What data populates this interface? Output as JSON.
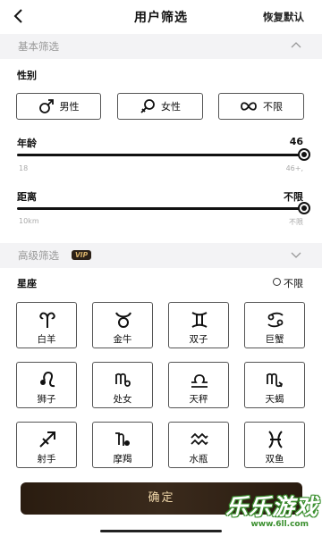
{
  "header": {
    "back_icon": "back-arrow-icon",
    "title": "用户筛选",
    "reset_label": "恢复默认"
  },
  "basic_section": {
    "title": "基本筛选",
    "gender": {
      "label": "性别",
      "options": [
        {
          "label": "男性",
          "icon": "male-icon"
        },
        {
          "label": "女性",
          "icon": "female-icon"
        },
        {
          "label": "不限",
          "icon": "infinity-icon"
        }
      ]
    },
    "age": {
      "label": "年龄",
      "value": "46",
      "min_label": "18",
      "max_label": "46+,",
      "slider_fraction": 1.0
    },
    "distance": {
      "label": "距离",
      "value": "不限",
      "min_label": "10km",
      "max_label": "不限",
      "slider_fraction": 1.0
    }
  },
  "advanced_section": {
    "title": "高级筛选",
    "vip_badge": "VIP",
    "zodiac": {
      "label": "星座",
      "unlimited_label": "不限",
      "signs": [
        {
          "label": "白羊",
          "icon": "aries-icon"
        },
        {
          "label": "金牛",
          "icon": "taurus-icon"
        },
        {
          "label": "双子",
          "icon": "gemini-icon"
        },
        {
          "label": "巨蟹",
          "icon": "cancer-icon"
        },
        {
          "label": "狮子",
          "icon": "leo-icon"
        },
        {
          "label": "处女",
          "icon": "virgo-icon"
        },
        {
          "label": "天秤",
          "icon": "libra-icon"
        },
        {
          "label": "天蝎",
          "icon": "scorpio-icon"
        },
        {
          "label": "射手",
          "icon": "sagittarius-icon"
        },
        {
          "label": "摩羯",
          "icon": "capricorn-icon"
        },
        {
          "label": "水瓶",
          "icon": "aquarius-icon"
        },
        {
          "label": "双鱼",
          "icon": "pisces-icon"
        }
      ]
    }
  },
  "confirm_label": "确定",
  "watermark": {
    "title": "乐乐游戏",
    "url": "www.6ll.com"
  },
  "colors": {
    "accent_dark": "#2a1c10",
    "confirm_text": "#f1d8aa",
    "vip_gold": "#d9b26a",
    "section_bg": "#f3f3f5"
  }
}
